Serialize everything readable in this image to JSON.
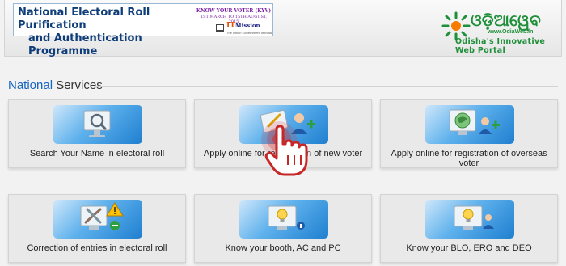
{
  "header": {
    "banner": {
      "title_line1": "National Electoral Roll Purification",
      "title_line2": "and Authentication Programme",
      "campaign": "KNOW YOUR VOTER (KYV)",
      "campaign_dates": "1ST MARCH TO 15TH AUGUST, 2015",
      "brand_prefix": "IT",
      "brand_name": "Mission",
      "brand_sub": "The Union Government of India"
    },
    "site_logo": {
      "script_name": "ଓଡ଼ିଆୱେବ",
      "url": "www.OdiaWeb.in",
      "tagline": "Odisha's Innovative Web Portal"
    }
  },
  "section": {
    "title_accent": "National",
    "title_rest": " Services"
  },
  "tiles": [
    {
      "label": "Search Your Name in electoral roll",
      "icon": "search-magnifier-icon"
    },
    {
      "label": "Apply online for registration of new voter",
      "icon": "register-user-icon"
    },
    {
      "label": "Apply online for registration of overseas voter",
      "icon": "overseas-voter-icon"
    },
    {
      "label": "Correction of entries in electoral roll",
      "icon": "correction-tools-icon"
    },
    {
      "label": "Know your booth, AC and PC",
      "icon": "booth-info-icon"
    },
    {
      "label": "Know your BLO, ERO and DEO",
      "icon": "officer-info-icon"
    }
  ],
  "colors": {
    "accent_blue": "#1565c0",
    "brand_green": "#1f8f3a",
    "banner_title": "#0e3d7a",
    "cursor_red": "#d32f2f"
  }
}
